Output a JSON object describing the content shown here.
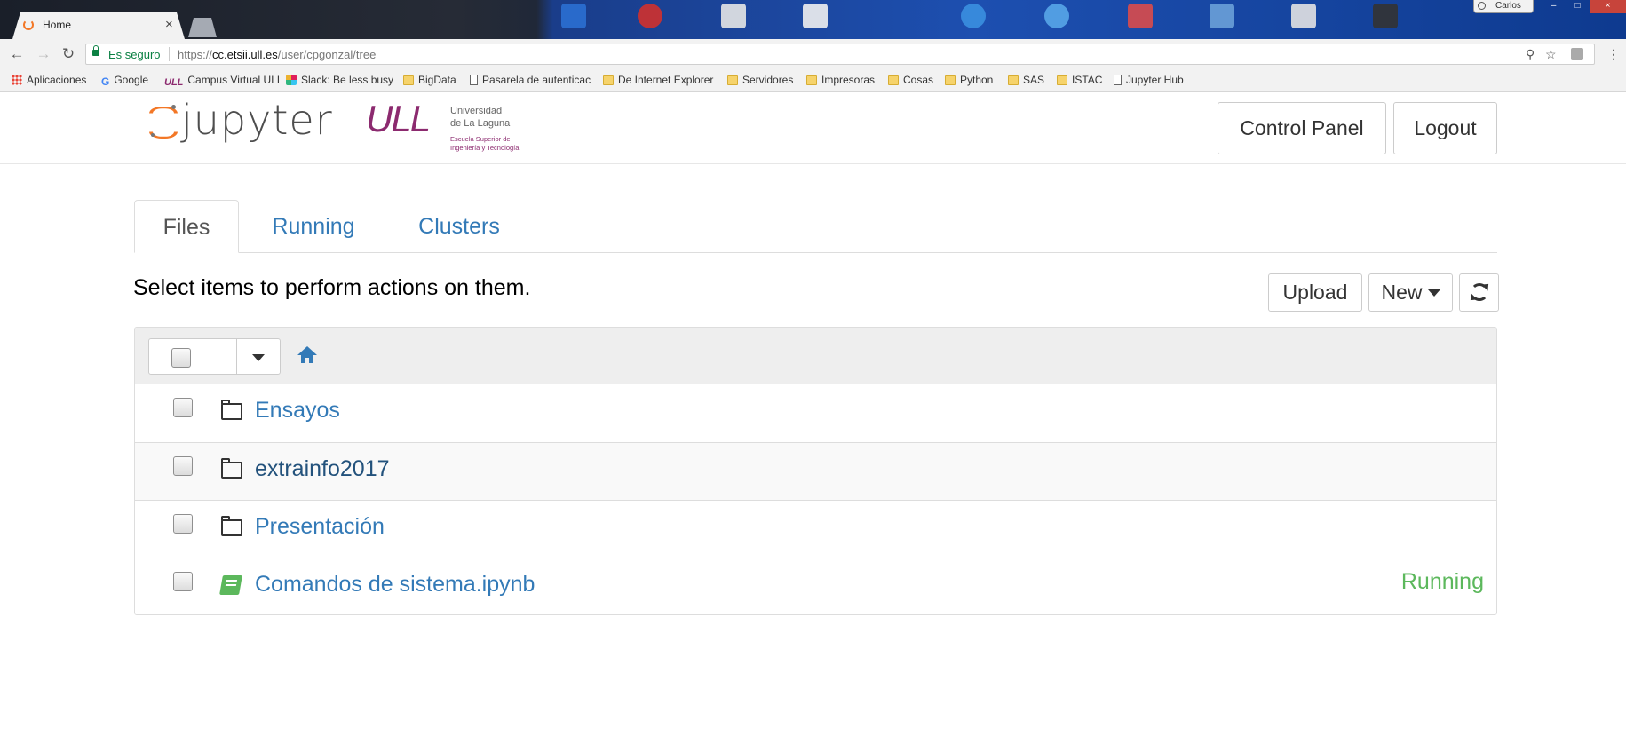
{
  "browser": {
    "tab_title": "Home",
    "tab_close": "×",
    "user_name": "Carlos",
    "window_buttons": [
      "–",
      "□",
      "×"
    ],
    "nav": {
      "back": "←",
      "forward": "→",
      "reload": "↻"
    },
    "secure_label": "Es seguro",
    "url": {
      "protocol": "https://",
      "host": "cc.etsii.ull.es",
      "path": "/user/cpgonzal/tree"
    },
    "omnibox_icons": [
      "zoom-icon",
      "star-icon",
      "pdf-extension-icon",
      "menu-icon"
    ],
    "menu_dots": "⋮",
    "zoom_glyph": "⚲",
    "star_glyph": "☆"
  },
  "bookmarks": [
    {
      "label": "Aplicaciones",
      "icon": "apps-icon"
    },
    {
      "label": "Google",
      "icon": "google-icon",
      "glyph": "G"
    },
    {
      "label": "Campus Virtual ULL",
      "icon": "ull-icon",
      "glyph": "ULL"
    },
    {
      "label": "Slack: Be less busy",
      "icon": "slack-icon"
    },
    {
      "label": "BigData",
      "icon": "folder-icon"
    },
    {
      "label": "Pasarela de autenticac",
      "icon": "page-icon"
    },
    {
      "label": "De Internet Explorer",
      "icon": "folder-icon"
    },
    {
      "label": "Servidores",
      "icon": "folder-icon"
    },
    {
      "label": "Impresoras",
      "icon": "folder-icon"
    },
    {
      "label": "Cosas",
      "icon": "folder-icon"
    },
    {
      "label": "Python",
      "icon": "folder-icon"
    },
    {
      "label": "SAS",
      "icon": "folder-icon"
    },
    {
      "label": "ISTAC",
      "icon": "folder-icon"
    },
    {
      "label": "Jupyter Hub",
      "icon": "page-icon"
    }
  ],
  "header": {
    "logo_text": "jupyter",
    "ull_mark": "ULL",
    "university_line1": "Universidad",
    "university_line2": "de La Laguna",
    "school_line1": "Escuela Superior de",
    "school_line2": "Ingeniería y Tecnología",
    "control_panel_label": "Control Panel",
    "logout_label": "Logout"
  },
  "tabs": [
    {
      "label": "Files",
      "active": true
    },
    {
      "label": "Running",
      "active": false
    },
    {
      "label": "Clusters",
      "active": false
    }
  ],
  "toolbar": {
    "hint": "Select items to perform actions on them.",
    "upload_label": "Upload",
    "new_label": "New"
  },
  "file_list": {
    "items": [
      {
        "name": "Ensayos",
        "type": "folder",
        "status": ""
      },
      {
        "name": "extrainfo2017",
        "type": "folder",
        "status": ""
      },
      {
        "name": "Presentación",
        "type": "folder",
        "status": ""
      },
      {
        "name": "Comandos de sistema.ipynb",
        "type": "notebook",
        "status": "Running"
      }
    ]
  },
  "colors": {
    "link": "#337ab7",
    "running": "#5cb85c",
    "jupyter_orange": "#f37726",
    "ull_purple": "#8c2a6f",
    "secure_green": "#0b8043"
  }
}
